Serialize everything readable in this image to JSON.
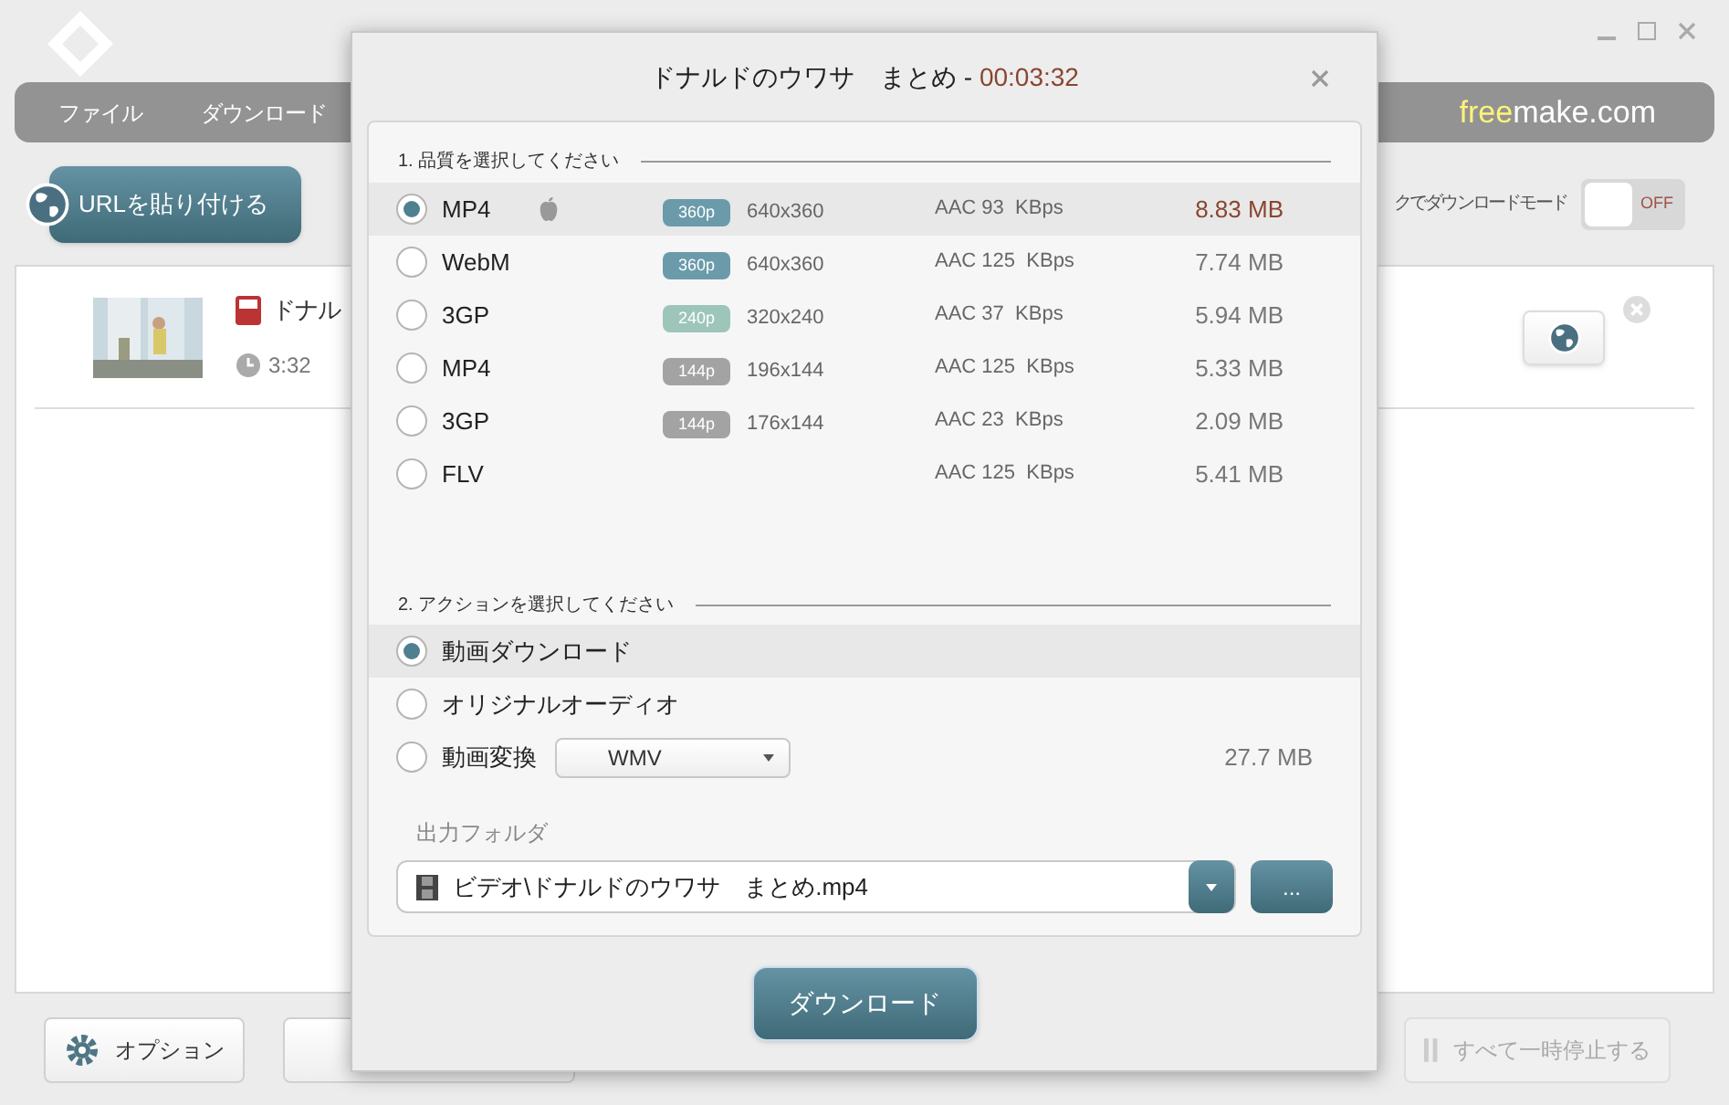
{
  "app": {
    "menu": [
      "ファイル",
      "ダウンロード"
    ],
    "brand_accent": "free",
    "brand_rest": "make.com",
    "paste_url_button": "URLを貼り付ける",
    "one_click_mode_label": "クでダウンロードモード",
    "one_click_toggle": {
      "label": "OFF",
      "on": false
    }
  },
  "download_list": [
    {
      "title": "ドナル",
      "duration": "3:32"
    }
  ],
  "bottom_bar": {
    "options_button": "オプション",
    "pause_all_button": {
      "label": "すべて一時停止する",
      "disabled": true
    }
  },
  "dialog": {
    "title": "ドナルドのウワサ　まとめ",
    "separator": " - ",
    "duration": "00:03:32",
    "quality_heading": "1. 品質を選択してください",
    "qualities": [
      {
        "format": "MP4",
        "apple_icon": true,
        "badge": "360p",
        "color": "#6b9bab",
        "resolution": "640x360",
        "audio": "AAC 93  KBps",
        "size": "8.83 MB",
        "selected": true
      },
      {
        "format": "WebM",
        "apple_icon": false,
        "badge": "360p",
        "color": "#6b9bab",
        "resolution": "640x360",
        "audio": "AAC 125  KBps",
        "size": "7.74 MB",
        "selected": false
      },
      {
        "format": "3GP",
        "apple_icon": false,
        "badge": "240p",
        "color": "#9dc5b9",
        "resolution": "320x240",
        "audio": "AAC 37  KBps",
        "size": "5.94 MB",
        "selected": false
      },
      {
        "format": "MP4",
        "apple_icon": false,
        "badge": "144p",
        "color": "#a3a3a3",
        "resolution": "196x144",
        "audio": "AAC 125  KBps",
        "size": "5.33 MB",
        "selected": false
      },
      {
        "format": "3GP",
        "apple_icon": false,
        "badge": "144p",
        "color": "#a3a3a3",
        "resolution": "176x144",
        "audio": "AAC 23  KBps",
        "size": "2.09 MB",
        "selected": false
      },
      {
        "format": "FLV",
        "apple_icon": false,
        "audio": "AAC 125  KBps",
        "size": "5.41 MB",
        "selected": false
      }
    ],
    "action_heading": "2. アクションを選択してください",
    "actions": [
      {
        "kind": "plain",
        "label": "動画ダウンロード",
        "selected": true
      },
      {
        "kind": "plain",
        "label": "オリジナルオーディオ",
        "selected": false
      },
      {
        "kind": "convert",
        "label": "動画変換",
        "format": "WMV",
        "size": "27.7 MB",
        "selected": false
      }
    ],
    "output_folder_label": "出力フォルダ",
    "output_path": "ビデオ\\ドナルドのウワサ　まとめ.mp4",
    "browse_button": "...",
    "download_button": "ダウンロード"
  }
}
